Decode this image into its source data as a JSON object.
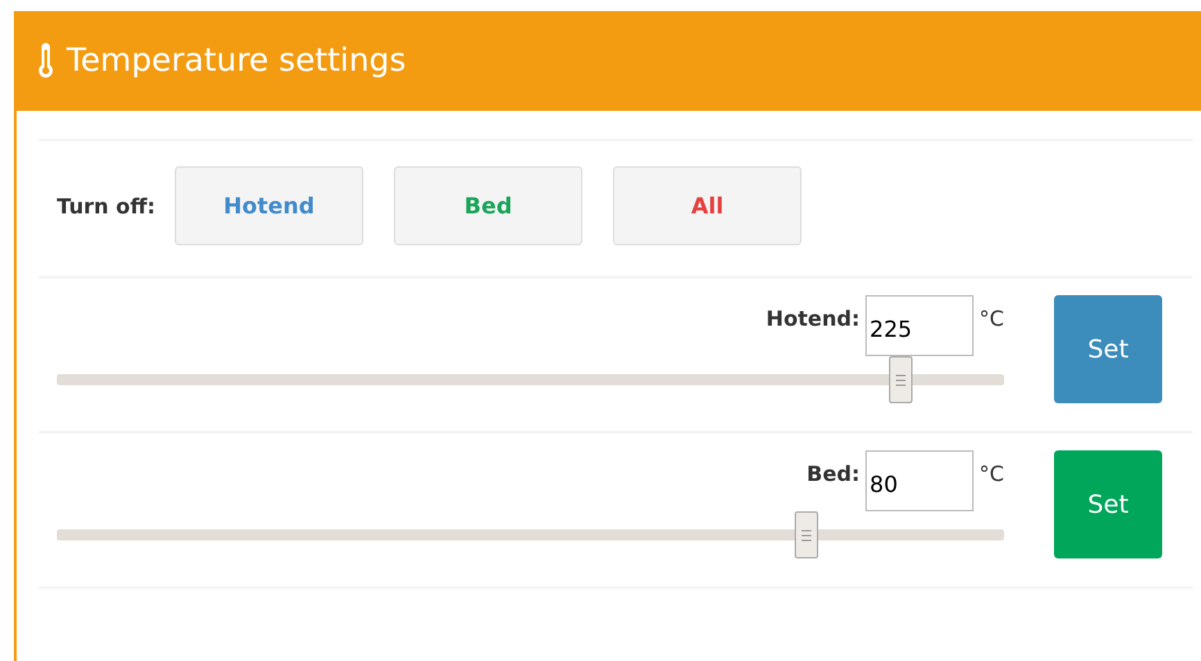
{
  "panel": {
    "title": "Temperature settings"
  },
  "turn_off": {
    "label": "Turn off:",
    "buttons": [
      {
        "label": "Hotend",
        "color": "#428bca"
      },
      {
        "label": "Bed",
        "color": "#1aa55a"
      },
      {
        "label": "All",
        "color": "#e5413f"
      }
    ]
  },
  "heaters": [
    {
      "label": "Hotend:",
      "value": "225",
      "unit": "°C",
      "level": 0.89,
      "button": "Set",
      "color": "#3c8dbc"
    },
    {
      "label": "Bed:",
      "value": "80",
      "unit": "°C",
      "level": 0.79,
      "button": "Set",
      "color": "#00a65a"
    }
  ]
}
